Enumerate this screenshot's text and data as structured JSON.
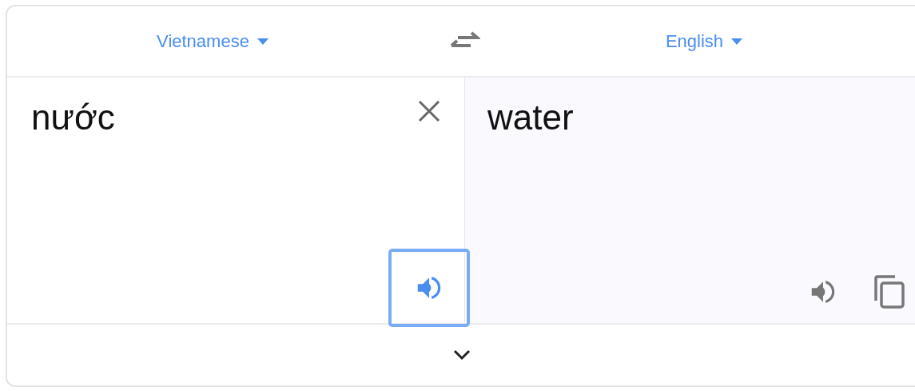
{
  "source_language": {
    "label": "Vietnamese"
  },
  "target_language": {
    "label": "English"
  },
  "source": {
    "text": "nước",
    "speaker_focused": true
  },
  "target": {
    "text": "water"
  }
}
